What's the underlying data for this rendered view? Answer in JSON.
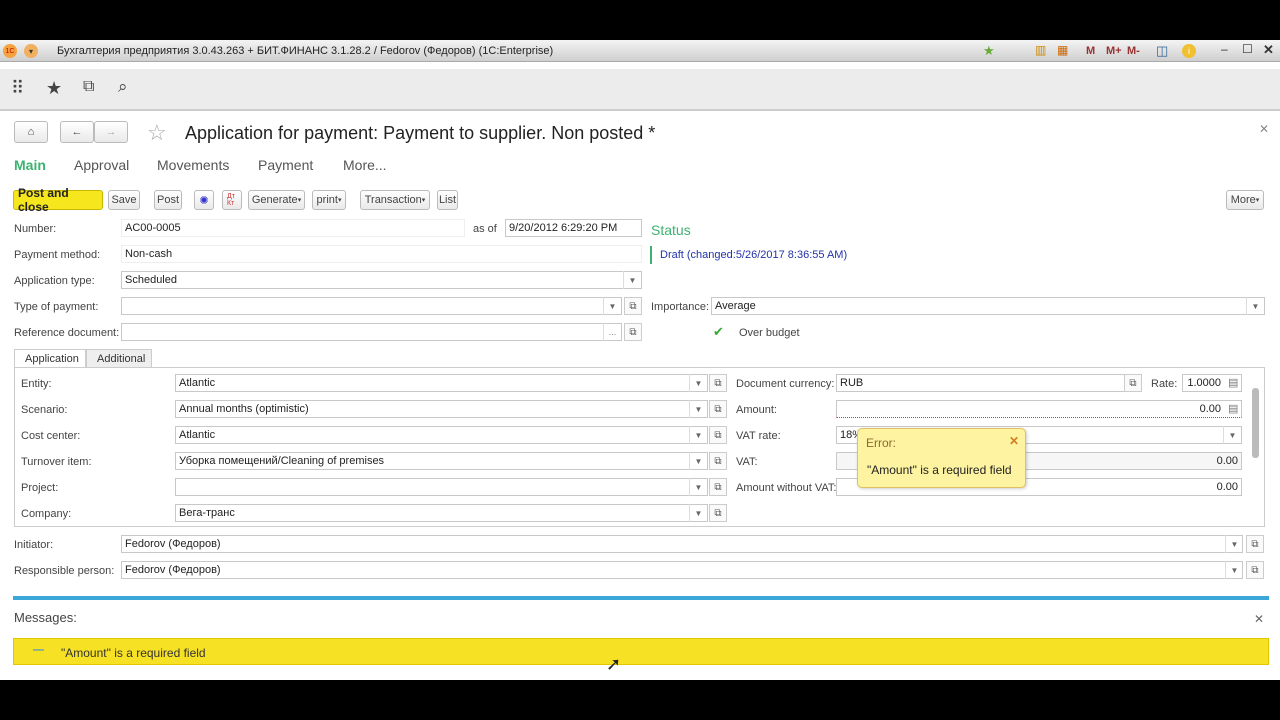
{
  "window": {
    "title": "Бухгалтерия предприятия 3.0.43.263 + БИТ.ФИНАНС 3.1.28.2 / Fedorov (Федоров)  (1C:Enterprise)",
    "toolbar_icons": [
      "M",
      "M+",
      "M-"
    ]
  },
  "document": {
    "title": "Application for payment: Payment to supplier. Non posted *"
  },
  "tabs": [
    {
      "label": "Main",
      "active": true
    },
    {
      "label": "Approval"
    },
    {
      "label": "Movements"
    },
    {
      "label": "Payment"
    },
    {
      "label": "More..."
    }
  ],
  "toolbar": {
    "post_close": "Post and close",
    "save": "Save",
    "post": "Post",
    "generate": "Generate",
    "print": "print",
    "transaction": "Transaction",
    "list": "List",
    "more": "More",
    "dtkt": "Дт Кт"
  },
  "header": {
    "number_label": "Number:",
    "number": "AC00-0005",
    "as_of_label": "as of",
    "date": "9/20/2012  6:29:20 PM",
    "status_label": "Status",
    "status": "Draft (changed:5/26/2017 8:36:55 AM)",
    "payment_method_label": "Payment method:",
    "payment_method": "Non-cash",
    "app_type_label": "Application type:",
    "app_type": "Scheduled",
    "type_payment_label": "Type of payment:",
    "type_payment": "",
    "importance_label": "Importance:",
    "importance": "Average",
    "ref_doc_label": "Reference document:",
    "ref_doc": "",
    "over_budget_label": "Over budget",
    "over_budget": true
  },
  "subtabs": [
    {
      "label": "Application",
      "active": true
    },
    {
      "label": "Additional"
    }
  ],
  "app": {
    "entity_label": "Entity:",
    "entity": "Atlantic",
    "scenario_label": "Scenario:",
    "scenario": "Annual months (optimistic)",
    "cost_center_label": "Cost center:",
    "cost_center": "Atlantic",
    "turnover_label": "Turnover item:",
    "turnover": "Уборка помещений/Cleaning of premises",
    "project_label": "Project:",
    "project": "",
    "company_label": "Company:",
    "company": "Вега-транс",
    "currency_label": "Document currency:",
    "currency": "RUB",
    "rate_label": "Rate:",
    "rate": "1.0000",
    "amount_label": "Amount:",
    "amount": "0.00",
    "vat_rate_label": "VAT rate:",
    "vat_rate": "18%",
    "vat_label": "VAT:",
    "vat": "0.00",
    "amount_wo_vat_label": "Amount without VAT:",
    "amount_wo_vat": "0.00"
  },
  "error_tip": {
    "title": "Error:",
    "text": "\"Amount\" is a required field"
  },
  "initiator_label": "Initiator:",
  "initiator": "Fedorov (Федоров)",
  "responsible_label": "Responsible person:",
  "responsible": "Fedorov (Федоров)",
  "messages": {
    "title": "Messages:",
    "items": [
      "\"Amount\" is a required field"
    ]
  },
  "colors": {
    "accent": "#3cb371",
    "post_close": "#f5e61e",
    "message_bar": "#f7e124",
    "divider": "#3aa7d8"
  }
}
